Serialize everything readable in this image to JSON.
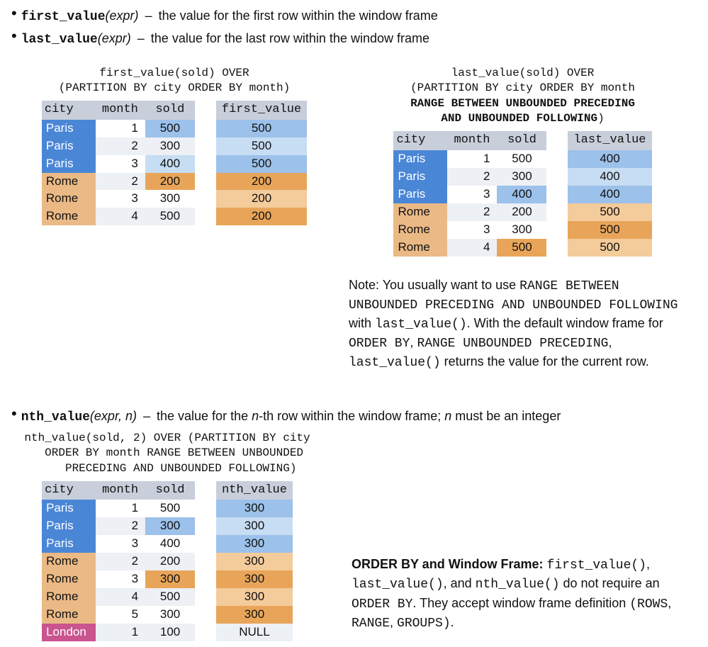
{
  "bullets": {
    "first_value": {
      "fn": "first_value",
      "arg": "(expr)",
      "desc": "the value for the first row within the window frame"
    },
    "last_value": {
      "fn": "last_value",
      "arg": "(expr)",
      "desc": "the value for the last row within the window frame"
    },
    "nth_value": {
      "fn": "nth_value",
      "arg": "(expr, n)",
      "desc_before": "the value for the ",
      "n_word": "n",
      "desc_mid": "-th row within the window frame; ",
      "n_word2": "n",
      "desc_after": " must be an integer"
    }
  },
  "captions": {
    "first": "first_value(sold) OVER\n(PARTITION BY city ORDER BY month)",
    "last_l1": "last_value(sold) OVER",
    "last_l2": "(PARTITION BY city ORDER BY month",
    "last_l3": "RANGE BETWEEN UNBOUNDED PRECEDING",
    "last_l4": "AND UNBOUNDED FOLLOWING",
    "last_l4_close": ")",
    "nth": "nth_value(sold, 2) OVER (PARTITION BY city\n  ORDER BY month RANGE BETWEEN UNBOUNDED\n    PRECEDING AND UNBOUNDED FOLLOWING)"
  },
  "headers": {
    "city": "city",
    "month": "month",
    "sold": "sold",
    "first": "first_value",
    "last": "last_value",
    "nth": "nth_value"
  },
  "table_first": [
    {
      "city": "Paris",
      "month": "1",
      "sold": "500",
      "res": "500",
      "cityCls": "blue-city",
      "rowCls": "",
      "soldCls": "sold-blue-dk",
      "resCls": "res-blue-dk"
    },
    {
      "city": "Paris",
      "month": "2",
      "sold": "300",
      "res": "500",
      "cityCls": "blue-city",
      "rowCls": "stripe-lt",
      "soldCls": "",
      "resCls": "res-blue-lt"
    },
    {
      "city": "Paris",
      "month": "3",
      "sold": "400",
      "res": "500",
      "cityCls": "blue-city",
      "rowCls": "",
      "soldCls": "sold-blue-lt",
      "resCls": "res-blue-dk"
    },
    {
      "city": "Rome",
      "month": "2",
      "sold": "200",
      "res": "200",
      "cityCls": "orange-city",
      "rowCls": "stripe-lt",
      "soldCls": "sold-orange-dk",
      "resCls": "res-orange-dk"
    },
    {
      "city": "Rome",
      "month": "3",
      "sold": "300",
      "res": "200",
      "cityCls": "orange-city",
      "rowCls": "",
      "soldCls": "",
      "resCls": "res-orange-lt"
    },
    {
      "city": "Rome",
      "month": "4",
      "sold": "500",
      "res": "200",
      "cityCls": "orange-city",
      "rowCls": "stripe-lt",
      "soldCls": "",
      "resCls": "res-orange-dk"
    }
  ],
  "table_last": [
    {
      "city": "Paris",
      "month": "1",
      "sold": "500",
      "res": "400",
      "cityCls": "blue-city",
      "rowCls": "",
      "soldCls": "",
      "resCls": "res-blue-dk"
    },
    {
      "city": "Paris",
      "month": "2",
      "sold": "300",
      "res": "400",
      "cityCls": "blue-city",
      "rowCls": "stripe-lt",
      "soldCls": "",
      "resCls": "res-blue-lt"
    },
    {
      "city": "Paris",
      "month": "3",
      "sold": "400",
      "res": "400",
      "cityCls": "blue-city",
      "rowCls": "",
      "soldCls": "sold-blue-dk",
      "resCls": "res-blue-dk"
    },
    {
      "city": "Rome",
      "month": "2",
      "sold": "200",
      "res": "500",
      "cityCls": "orange-city",
      "rowCls": "stripe-lt",
      "soldCls": "",
      "resCls": "res-orange-lt"
    },
    {
      "city": "Rome",
      "month": "3",
      "sold": "300",
      "res": "500",
      "cityCls": "orange-city",
      "rowCls": "",
      "soldCls": "",
      "resCls": "res-orange-dk"
    },
    {
      "city": "Rome",
      "month": "4",
      "sold": "500",
      "res": "500",
      "cityCls": "orange-city",
      "rowCls": "stripe-lt",
      "soldCls": "sold-orange-dk",
      "resCls": "res-orange-lt"
    }
  ],
  "table_nth": [
    {
      "city": "Paris",
      "month": "1",
      "sold": "500",
      "res": "300",
      "cityCls": "blue-city",
      "rowCls": "",
      "soldCls": "",
      "resCls": "res-blue-dk"
    },
    {
      "city": "Paris",
      "month": "2",
      "sold": "300",
      "res": "300",
      "cityCls": "blue-city",
      "rowCls": "stripe-lt",
      "soldCls": "sold-blue-dk",
      "resCls": "res-blue-lt"
    },
    {
      "city": "Paris",
      "month": "3",
      "sold": "400",
      "res": "300",
      "cityCls": "blue-city",
      "rowCls": "",
      "soldCls": "",
      "resCls": "res-blue-dk"
    },
    {
      "city": "Rome",
      "month": "2",
      "sold": "200",
      "res": "300",
      "cityCls": "orange-city",
      "rowCls": "stripe-lt",
      "soldCls": "",
      "resCls": "res-orange-lt"
    },
    {
      "city": "Rome",
      "month": "3",
      "sold": "300",
      "res": "300",
      "cityCls": "orange-city",
      "rowCls": "",
      "soldCls": "sold-orange-dk",
      "resCls": "res-orange-dk"
    },
    {
      "city": "Rome",
      "month": "4",
      "sold": "500",
      "res": "300",
      "cityCls": "orange-city",
      "rowCls": "stripe-lt",
      "soldCls": "",
      "resCls": "res-orange-lt"
    },
    {
      "city": "Rome",
      "month": "5",
      "sold": "300",
      "res": "300",
      "cityCls": "orange-city",
      "rowCls": "",
      "soldCls": "",
      "resCls": "res-orange-dk"
    },
    {
      "city": "London",
      "month": "1",
      "sold": "100",
      "res": "NULL",
      "cityCls": "pink-city",
      "rowCls": "stripe-lt",
      "soldCls": "",
      "resCls": "stripe-lt"
    }
  ],
  "note": {
    "prefix": "Note: You usually want to use ",
    "c1": "RANGE BETWEEN UNBOUNDED PRECEDING AND UNBOUNDED FOLLOWING",
    "mid1": " with ",
    "c2": "last_value()",
    "mid2": ". With the default window frame for ",
    "c3": "ORDER BY",
    "mid3": ", ",
    "c4": "RANGE UNBOUNDED PRECEDING",
    "mid4": ", ",
    "c5": "last_value()",
    "suffix": " returns the value for the current row."
  },
  "footer": {
    "boldLead": "ORDER BY and Window Frame:",
    "sp": " ",
    "c1": "first_value()",
    "mid1": ", ",
    "c2": "last_value()",
    "mid2": ", and ",
    "c3": "nth_value()",
    "mid3": " do not require an ",
    "c4": "ORDER BY",
    "mid4": ". They accept window frame definition ",
    "c5": "(ROWS",
    "mid5": ", ",
    "c6": "RANGE",
    "mid6": ", ",
    "c7": "GROUPS)",
    "period": "."
  }
}
